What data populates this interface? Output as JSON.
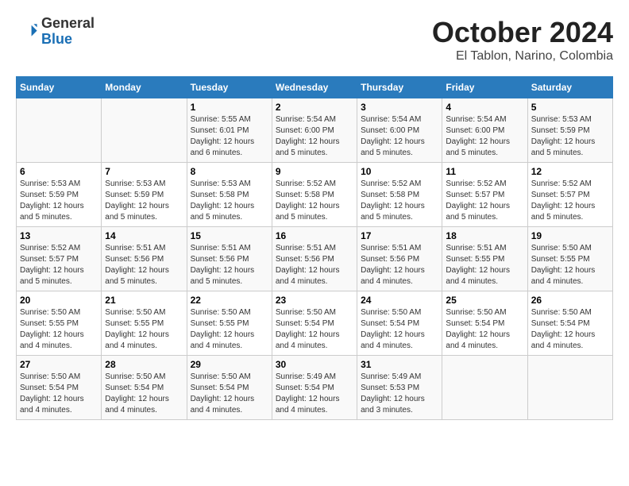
{
  "header": {
    "logo": {
      "line1": "General",
      "line2": "Blue"
    },
    "title": "October 2024",
    "location": "El Tablon, Narino, Colombia"
  },
  "days_of_week": [
    "Sunday",
    "Monday",
    "Tuesday",
    "Wednesday",
    "Thursday",
    "Friday",
    "Saturday"
  ],
  "weeks": [
    [
      {
        "day": "",
        "info": ""
      },
      {
        "day": "",
        "info": ""
      },
      {
        "day": "1",
        "info": "Sunrise: 5:55 AM\nSunset: 6:01 PM\nDaylight: 12 hours and 6 minutes."
      },
      {
        "day": "2",
        "info": "Sunrise: 5:54 AM\nSunset: 6:00 PM\nDaylight: 12 hours and 5 minutes."
      },
      {
        "day": "3",
        "info": "Sunrise: 5:54 AM\nSunset: 6:00 PM\nDaylight: 12 hours and 5 minutes."
      },
      {
        "day": "4",
        "info": "Sunrise: 5:54 AM\nSunset: 6:00 PM\nDaylight: 12 hours and 5 minutes."
      },
      {
        "day": "5",
        "info": "Sunrise: 5:53 AM\nSunset: 5:59 PM\nDaylight: 12 hours and 5 minutes."
      }
    ],
    [
      {
        "day": "6",
        "info": "Sunrise: 5:53 AM\nSunset: 5:59 PM\nDaylight: 12 hours and 5 minutes."
      },
      {
        "day": "7",
        "info": "Sunrise: 5:53 AM\nSunset: 5:59 PM\nDaylight: 12 hours and 5 minutes."
      },
      {
        "day": "8",
        "info": "Sunrise: 5:53 AM\nSunset: 5:58 PM\nDaylight: 12 hours and 5 minutes."
      },
      {
        "day": "9",
        "info": "Sunrise: 5:52 AM\nSunset: 5:58 PM\nDaylight: 12 hours and 5 minutes."
      },
      {
        "day": "10",
        "info": "Sunrise: 5:52 AM\nSunset: 5:58 PM\nDaylight: 12 hours and 5 minutes."
      },
      {
        "day": "11",
        "info": "Sunrise: 5:52 AM\nSunset: 5:57 PM\nDaylight: 12 hours and 5 minutes."
      },
      {
        "day": "12",
        "info": "Sunrise: 5:52 AM\nSunset: 5:57 PM\nDaylight: 12 hours and 5 minutes."
      }
    ],
    [
      {
        "day": "13",
        "info": "Sunrise: 5:52 AM\nSunset: 5:57 PM\nDaylight: 12 hours and 5 minutes."
      },
      {
        "day": "14",
        "info": "Sunrise: 5:51 AM\nSunset: 5:56 PM\nDaylight: 12 hours and 5 minutes."
      },
      {
        "day": "15",
        "info": "Sunrise: 5:51 AM\nSunset: 5:56 PM\nDaylight: 12 hours and 5 minutes."
      },
      {
        "day": "16",
        "info": "Sunrise: 5:51 AM\nSunset: 5:56 PM\nDaylight: 12 hours and 4 minutes."
      },
      {
        "day": "17",
        "info": "Sunrise: 5:51 AM\nSunset: 5:56 PM\nDaylight: 12 hours and 4 minutes."
      },
      {
        "day": "18",
        "info": "Sunrise: 5:51 AM\nSunset: 5:55 PM\nDaylight: 12 hours and 4 minutes."
      },
      {
        "day": "19",
        "info": "Sunrise: 5:50 AM\nSunset: 5:55 PM\nDaylight: 12 hours and 4 minutes."
      }
    ],
    [
      {
        "day": "20",
        "info": "Sunrise: 5:50 AM\nSunset: 5:55 PM\nDaylight: 12 hours and 4 minutes."
      },
      {
        "day": "21",
        "info": "Sunrise: 5:50 AM\nSunset: 5:55 PM\nDaylight: 12 hours and 4 minutes."
      },
      {
        "day": "22",
        "info": "Sunrise: 5:50 AM\nSunset: 5:55 PM\nDaylight: 12 hours and 4 minutes."
      },
      {
        "day": "23",
        "info": "Sunrise: 5:50 AM\nSunset: 5:54 PM\nDaylight: 12 hours and 4 minutes."
      },
      {
        "day": "24",
        "info": "Sunrise: 5:50 AM\nSunset: 5:54 PM\nDaylight: 12 hours and 4 minutes."
      },
      {
        "day": "25",
        "info": "Sunrise: 5:50 AM\nSunset: 5:54 PM\nDaylight: 12 hours and 4 minutes."
      },
      {
        "day": "26",
        "info": "Sunrise: 5:50 AM\nSunset: 5:54 PM\nDaylight: 12 hours and 4 minutes."
      }
    ],
    [
      {
        "day": "27",
        "info": "Sunrise: 5:50 AM\nSunset: 5:54 PM\nDaylight: 12 hours and 4 minutes."
      },
      {
        "day": "28",
        "info": "Sunrise: 5:50 AM\nSunset: 5:54 PM\nDaylight: 12 hours and 4 minutes."
      },
      {
        "day": "29",
        "info": "Sunrise: 5:50 AM\nSunset: 5:54 PM\nDaylight: 12 hours and 4 minutes."
      },
      {
        "day": "30",
        "info": "Sunrise: 5:49 AM\nSunset: 5:54 PM\nDaylight: 12 hours and 4 minutes."
      },
      {
        "day": "31",
        "info": "Sunrise: 5:49 AM\nSunset: 5:53 PM\nDaylight: 12 hours and 3 minutes."
      },
      {
        "day": "",
        "info": ""
      },
      {
        "day": "",
        "info": ""
      }
    ]
  ]
}
